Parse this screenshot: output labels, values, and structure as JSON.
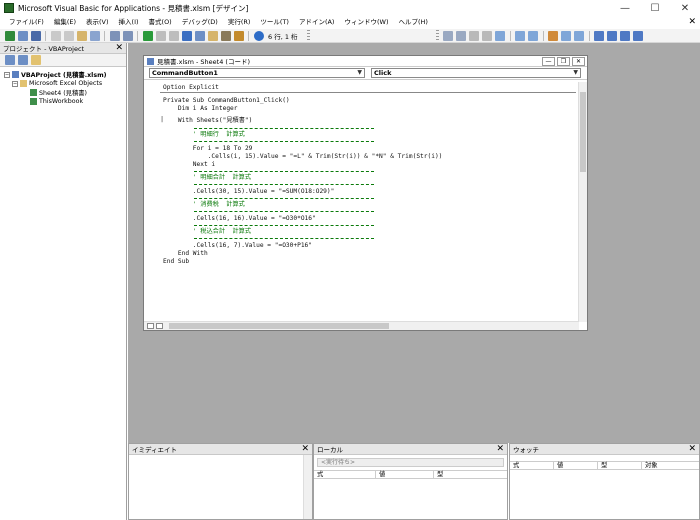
{
  "window": {
    "title": "Microsoft Visual Basic for Applications - 見積書.xlsm [デザイン]"
  },
  "menubar": {
    "items": [
      {
        "label": "ファイル(F)"
      },
      {
        "label": "編集(E)"
      },
      {
        "label": "表示(V)"
      },
      {
        "label": "挿入(I)"
      },
      {
        "label": "書式(O)"
      },
      {
        "label": "デバッグ(D)"
      },
      {
        "label": "実行(R)"
      },
      {
        "label": "ツール(T)"
      },
      {
        "label": "アドイン(A)"
      },
      {
        "label": "ウィンドウ(W)"
      },
      {
        "label": "ヘルプ(H)"
      }
    ]
  },
  "toolbar": {
    "position": "6 行, 1 桁"
  },
  "project_panel": {
    "title": "プロジェクト - VBAProject",
    "tree": {
      "root": "VBAProject (見積書.xlsm)",
      "folder": "Microsoft Excel Objects",
      "items": [
        "Sheet4 (見積書)",
        "ThisWorkbook"
      ]
    }
  },
  "code_window": {
    "title": "見積書.xlsm - Sheet4 (コード)",
    "object_select": "CommandButton1",
    "proc_select": "Click",
    "lines": [
      {
        "text": "Option Explicit",
        "kind": "code"
      },
      {
        "text": "Private Sub CommandButton1_Click()",
        "kind": "code"
      },
      {
        "text": "    Dim i As Integer",
        "kind": "code"
      },
      {
        "text": "    With Sheets(\"見積書\")",
        "kind": "code"
      },
      {
        "text": "        ' 明細行  計算式",
        "kind": "comment"
      },
      {
        "text": "        For i = 18 To 29",
        "kind": "code"
      },
      {
        "text": "            .Cells(i, 15).Value = \"=L\" & Trim(Str(i)) & \"*N\" & Trim(Str(i))",
        "kind": "code"
      },
      {
        "text": "        Next i",
        "kind": "code"
      },
      {
        "text": "        ' 明細合計  計算式",
        "kind": "comment"
      },
      {
        "text": "        .Cells(30, 15).Value = \"=SUM(O18:O29)\"",
        "kind": "code"
      },
      {
        "text": "        ' 消費税  計算式",
        "kind": "comment"
      },
      {
        "text": "        .Cells(16, 16).Value = \"=O30*O16\"",
        "kind": "code"
      },
      {
        "text": "        ' 税込合計  計算式",
        "kind": "comment"
      },
      {
        "text": "        .Cells(16, 7).Value = \"=O30+P16\"",
        "kind": "code"
      },
      {
        "text": "    End With",
        "kind": "code"
      },
      {
        "text": "End Sub",
        "kind": "code"
      }
    ]
  },
  "immediate_panel": {
    "title": "イミディエイト"
  },
  "locals_panel": {
    "title": "ローカル",
    "field": "<実行待ち>",
    "columns": [
      "式",
      "値",
      "型"
    ]
  },
  "watch_panel": {
    "title": "ウォッチ",
    "columns": [
      "式",
      "値",
      "型",
      "対象"
    ]
  },
  "colors": {
    "comment": "#0a7a0a",
    "mdi_background": "#a9a9a9"
  }
}
